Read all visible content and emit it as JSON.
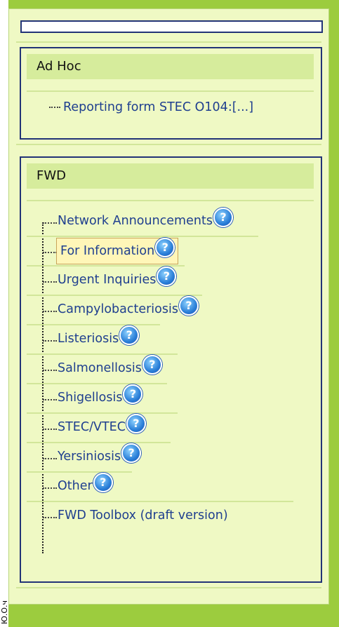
{
  "side_label": "Ю.О.ч",
  "sections": {
    "adhoc": {
      "header": "Ad Hoc",
      "items": [
        {
          "label": "Reporting form STEC O104:[...]"
        }
      ]
    },
    "fwd": {
      "header": "FWD",
      "items": [
        {
          "label": "Network Announcements",
          "help": "?"
        },
        {
          "label": "For Information",
          "help": "?",
          "selected": true
        },
        {
          "label": "Urgent Inquiries",
          "help": "?"
        },
        {
          "label": "Campylobacteriosis",
          "help": "?"
        },
        {
          "label": "Listeriosis",
          "help": "?"
        },
        {
          "label": "Salmonellosis",
          "help": "?"
        },
        {
          "label": "Shigellosis",
          "help": "?"
        },
        {
          "label": "STEC/VTEC",
          "help": "?"
        },
        {
          "label": "Yersiniosis",
          "help": "?"
        },
        {
          "label": "Other",
          "help": "?"
        },
        {
          "label": "FWD Toolbox (draft version)"
        }
      ]
    }
  },
  "colors": {
    "background": "#9ccc3e",
    "panel": "#eff9c4",
    "section_border": "#223377",
    "header_bg": "#d6ec9c",
    "link": "#1f3f8f",
    "selected_bg": "#fff6b8",
    "help_icon": "#2a7fd8"
  }
}
